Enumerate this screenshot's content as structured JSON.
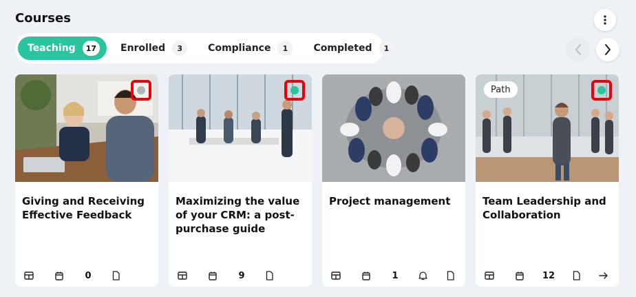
{
  "page": {
    "title": "Courses"
  },
  "tabs": [
    {
      "label": "Teaching",
      "count": "17",
      "active": true
    },
    {
      "label": "Enrolled",
      "count": "3",
      "active": false
    },
    {
      "label": "Compliance",
      "count": "1",
      "active": false
    },
    {
      "label": "Completed",
      "count": "1",
      "active": false
    }
  ],
  "colors": {
    "accent": "#2bc4a0",
    "highlight": "#e8000c"
  },
  "cards": [
    {
      "title": "Giving and Receiving Effective Feedback",
      "count": "0",
      "icons": [
        "table-icon",
        "calendar-icon",
        "document-icon"
      ]
    },
    {
      "title": "Maximizing the value of your CRM: a post-purchase guide",
      "count": "9",
      "icons": [
        "table-icon",
        "calendar-icon",
        "document-icon"
      ]
    },
    {
      "title": "Project management",
      "count": "1",
      "icons": [
        "table-icon",
        "calendar-icon",
        "bell-icon",
        "document-icon"
      ]
    },
    {
      "title": "Team Leadership and Collaboration",
      "count": "12",
      "badge": "Path",
      "icons": [
        "table-icon",
        "calendar-icon",
        "document-icon",
        "arrow-right-icon"
      ]
    }
  ]
}
